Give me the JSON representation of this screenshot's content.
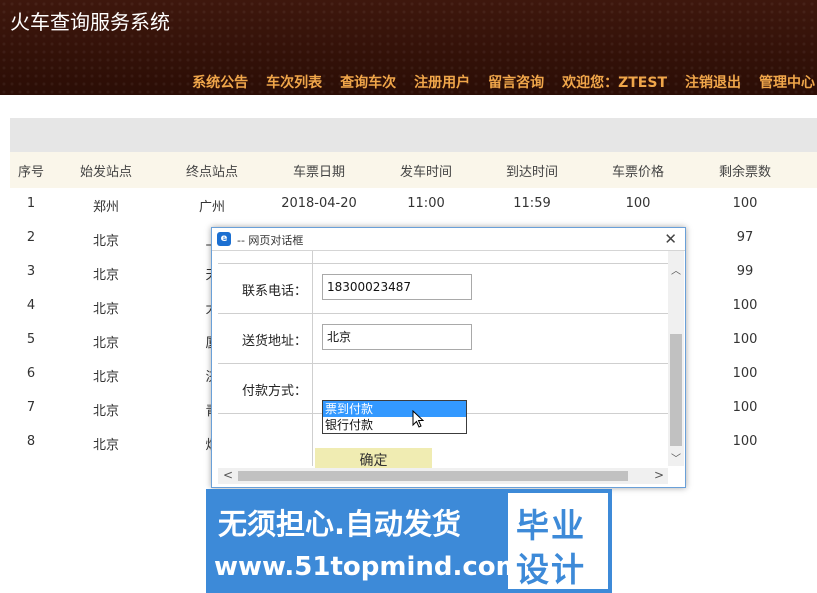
{
  "header": {
    "title": "火车查询服务系统",
    "nav": [
      "系统公告",
      "车次列表",
      "查询车次",
      "注册用户",
      "留言咨询",
      "欢迎您：ZTEST",
      "注销退出",
      "管理中心"
    ]
  },
  "table": {
    "columns": [
      "序号",
      "始发站点",
      "终点站点",
      "车票日期",
      "发车时间",
      "到达时间",
      "车票价格",
      "剩余票数"
    ],
    "rows": [
      [
        "1",
        "郑州",
        "广州",
        "2018-04-20",
        "11:00",
        "11:59",
        "100",
        "100"
      ],
      [
        "2",
        "北京",
        "上",
        "",
        "",
        "",
        "",
        "97"
      ],
      [
        "3",
        "北京",
        "天",
        "",
        "",
        "",
        "",
        "99"
      ],
      [
        "4",
        "北京",
        "大",
        "",
        "",
        "",
        "",
        "100"
      ],
      [
        "5",
        "北京",
        "厦",
        "",
        "",
        "",
        "",
        "100"
      ],
      [
        "6",
        "北京",
        "济",
        "",
        "",
        "",
        "",
        "100"
      ],
      [
        "7",
        "北京",
        "青",
        "",
        "",
        "",
        "",
        "100"
      ],
      [
        "8",
        "北京",
        "烟",
        "",
        "",
        "",
        "",
        "100"
      ]
    ]
  },
  "dialog": {
    "title": "-- 网页对话框",
    "phone_label": "联系电话：",
    "phone_value": "18300023487",
    "address_label": "送货地址：",
    "address_value": "北京",
    "payment_label": "付款方式：",
    "payment_options": [
      "票到付款",
      "银行付款"
    ],
    "selected_option": "票到付款",
    "ok_label": "确定"
  },
  "watermark": {
    "line1": "无须担心.自动发货",
    "line2": "www.51topmind.com",
    "box_line1": "毕业",
    "box_line2": "设计"
  },
  "colors": {
    "header_bg": "#2b0d05",
    "nav_text": "#f0a64a",
    "selected_option": "#3399ff",
    "ok_button": "#f0ecb2",
    "watermark_bg": "#3d8ad8"
  }
}
